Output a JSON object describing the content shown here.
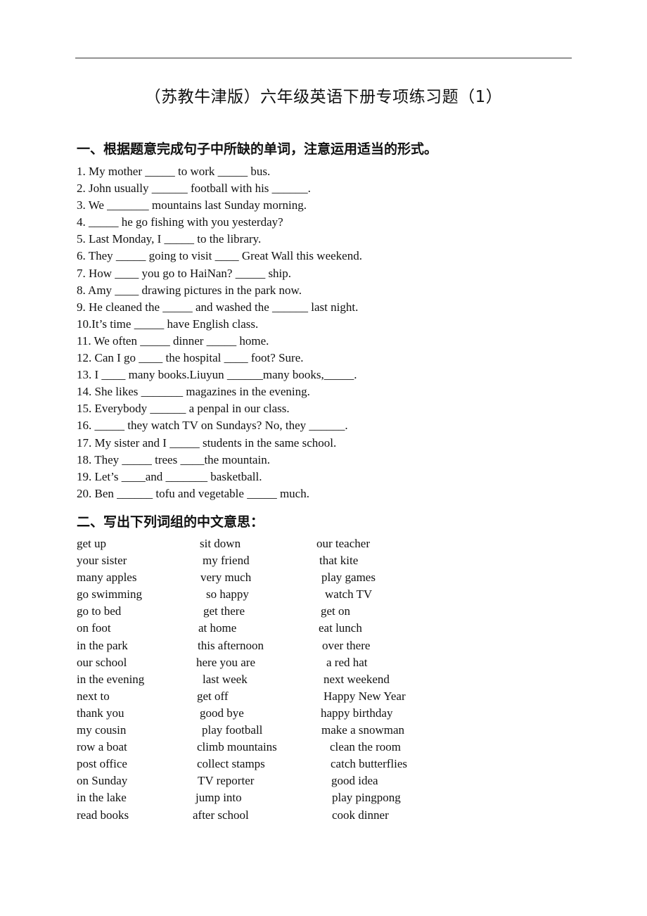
{
  "document": {
    "title": "（苏教牛津版）六年级英语下册专项练习题（1）",
    "section1": {
      "heading": "一、根据题意完成句子中所缺的单词，注意运用适当的形式。",
      "questions": [
        "1. My mother _____ to work _____ bus.",
        "2. John usually ______ football with his ______.",
        "3. We _______ mountains last Sunday morning.",
        "4. _____ he go fishing with you yesterday?",
        "5. Last Monday, I _____ to the library.",
        "6. They _____ going to visit ____ Great Wall this weekend.",
        "7. How ____ you go to HaiNan? _____ ship.",
        "8. Amy ____ drawing pictures in the park now.",
        "9. He cleaned the _____ and washed the ______ last night.",
        "10.It’s time _____ have English class.",
        "11. We often _____ dinner _____ home.",
        "12. Can I go ____ the hospital ____ foot? Sure.",
        "13. I ____ many books.Liuyun ______many books,_____.",
        "14. She likes _______ magazines in the evening.",
        "15. Everybody ______ a penpal in our class.",
        "16. _____ they watch TV on Sundays? No, they ______.",
        "17. My sister and I _____ students in the same school.",
        "18. They _____ trees ____the mountain.",
        "19. Let’s ____and _______ basketball.",
        "20. Ben ______ tofu and vegetable _____ much."
      ]
    },
    "section2": {
      "heading": "二、写出下列词组的中文意思：",
      "rows": [
        [
          "get up",
          "sit down",
          "our teacher"
        ],
        [
          "your sister",
          "my friend",
          "that kite"
        ],
        [
          "many apples",
          "very much",
          "play games"
        ],
        [
          "go swimming",
          "so happy",
          "watch TV"
        ],
        [
          "go to bed",
          "get there",
          "get on"
        ],
        [
          "on foot",
          "at home",
          "eat lunch"
        ],
        [
          "in the park",
          "this afternoon",
          "over there"
        ],
        [
          "our school",
          "here you are",
          "a red hat"
        ],
        [
          "in the evening",
          "last week",
          "next weekend"
        ],
        [
          "next to",
          "get off",
          "Happy New Year"
        ],
        [
          "thank you",
          "good bye",
          "happy birthday"
        ],
        [
          "my cousin",
          "play football",
          "make a snowman"
        ],
        [
          "row a boat",
          "climb mountains",
          "clean the room"
        ],
        [
          "post office",
          "collect stamps",
          "catch butterflies"
        ],
        [
          "on Sunday",
          "TV reporter",
          "good idea"
        ],
        [
          "in the lake",
          "jump into",
          "play pingpong"
        ],
        [
          "read books",
          "after school",
          "cook dinner"
        ]
      ]
    }
  }
}
